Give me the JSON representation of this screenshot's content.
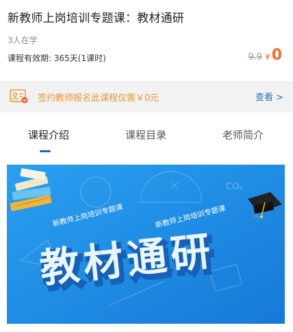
{
  "course": {
    "title": "新教师上岗培训专题课：教材通研",
    "learners": "3人在学",
    "validity": "课程有效期: 365天(1课时)",
    "original_price": "9.9",
    "currency_symbol": "¥",
    "price": "0"
  },
  "promo": {
    "text": "签约教师报名此课程仅需￥0元",
    "link": "查看 >",
    "icon": "certificate-icon"
  },
  "tabs": [
    {
      "label": "课程介绍",
      "active": true
    },
    {
      "label": "课程目录",
      "active": false
    },
    {
      "label": "老师简介",
      "active": false
    }
  ],
  "banner": {
    "subtitle_left": "新教师上岗培训专题课",
    "subtitle_right": "新教师上岗培训专题课",
    "title": "教材通研",
    "decor_text": "CO₂",
    "icons": [
      "books-stack-icon",
      "graduation-cap-icon"
    ],
    "colors": {
      "background": "#1e8fe6",
      "title_fill": "#eaf6ff",
      "title_shadow": "#1660b5"
    }
  },
  "colors": {
    "accent": "#f26a2b",
    "promo_text": "#e8982e",
    "link": "#2a72c9",
    "tab_indicator": "#1f5fbf"
  }
}
